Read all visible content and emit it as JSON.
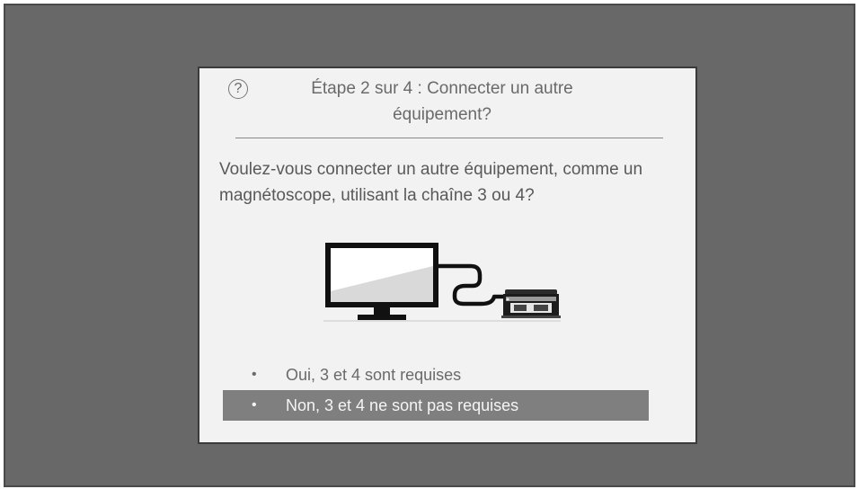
{
  "dialog": {
    "title": "Étape 2 sur 4 : Connecter un autre équipement?",
    "help_symbol": "?",
    "help_icon": "question-circle-icon",
    "question": "Voulez-vous connecter un autre équipement, comme un magnétoscope, utilisant la chaîne 3 ou 4?",
    "illustration": "tv-connected-to-vcr",
    "options": [
      {
        "label": "Oui, 3 et 4 sont requises",
        "selected": false
      },
      {
        "label": "Non, 3 et 4 ne sont pas requises",
        "selected": true
      }
    ],
    "bullet": "•"
  },
  "colors": {
    "screen_background": "#686868",
    "dialog_background": "#f2f2f2",
    "selected_background": "#7f7f7f"
  }
}
